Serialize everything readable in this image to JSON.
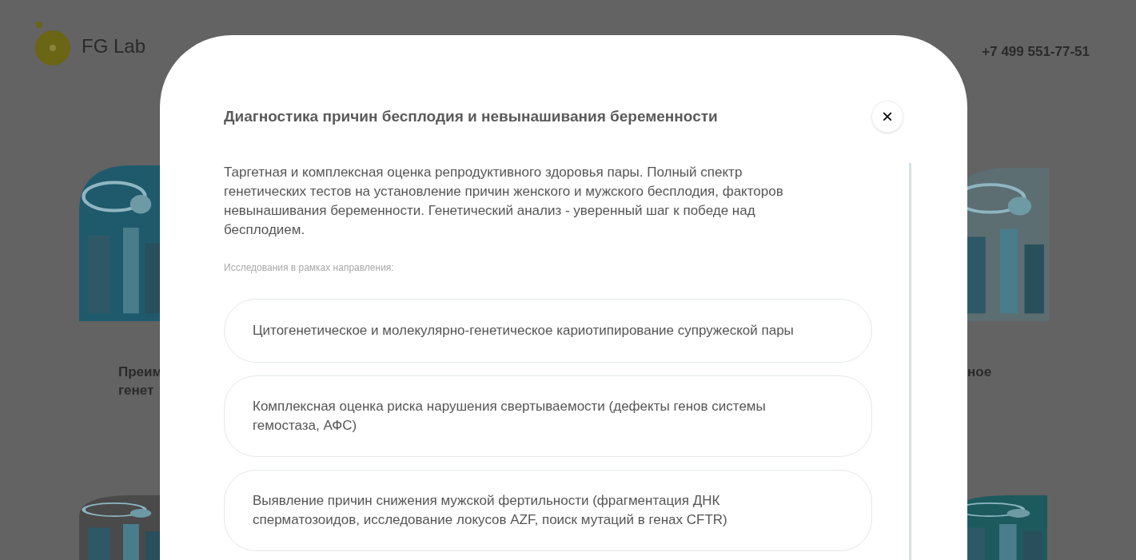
{
  "header": {
    "logo": "FG Lab",
    "phone": "+7 499 551-77-51"
  },
  "background_cards": [
    {
      "lines": [
        "Преим",
        "генет"
      ]
    },
    {
      "lines": [
        "ное"
      ]
    }
  ],
  "modal": {
    "title": "Диагностика причин бесплодия и невынашивания беременности",
    "close": "×",
    "description": "Таргетная и комплексная оценка репродуктивного здоровья пары. Полный спектр генетических тестов на установление причин женского и мужского бесплодия, факторов невынашивания беременности. Генетический анализ - уверенный шаг к победе над бесплодием.",
    "list_label": "Исследования в рамках направления:",
    "studies": [
      {
        "label": "Цитогенетическое и молекулярно-генетическое кариотипирование супружеской пары"
      },
      {
        "label": "Комплексная оценка риска нарушения свертываемости (дефекты генов системы гемостаза, АФС)"
      },
      {
        "label": "Выявление причин снижения мужской фертильности (фрагментация ДНК сперматозоидов, исследование локусов AZF, поиск мутаций в генах CFTR)"
      }
    ]
  }
}
